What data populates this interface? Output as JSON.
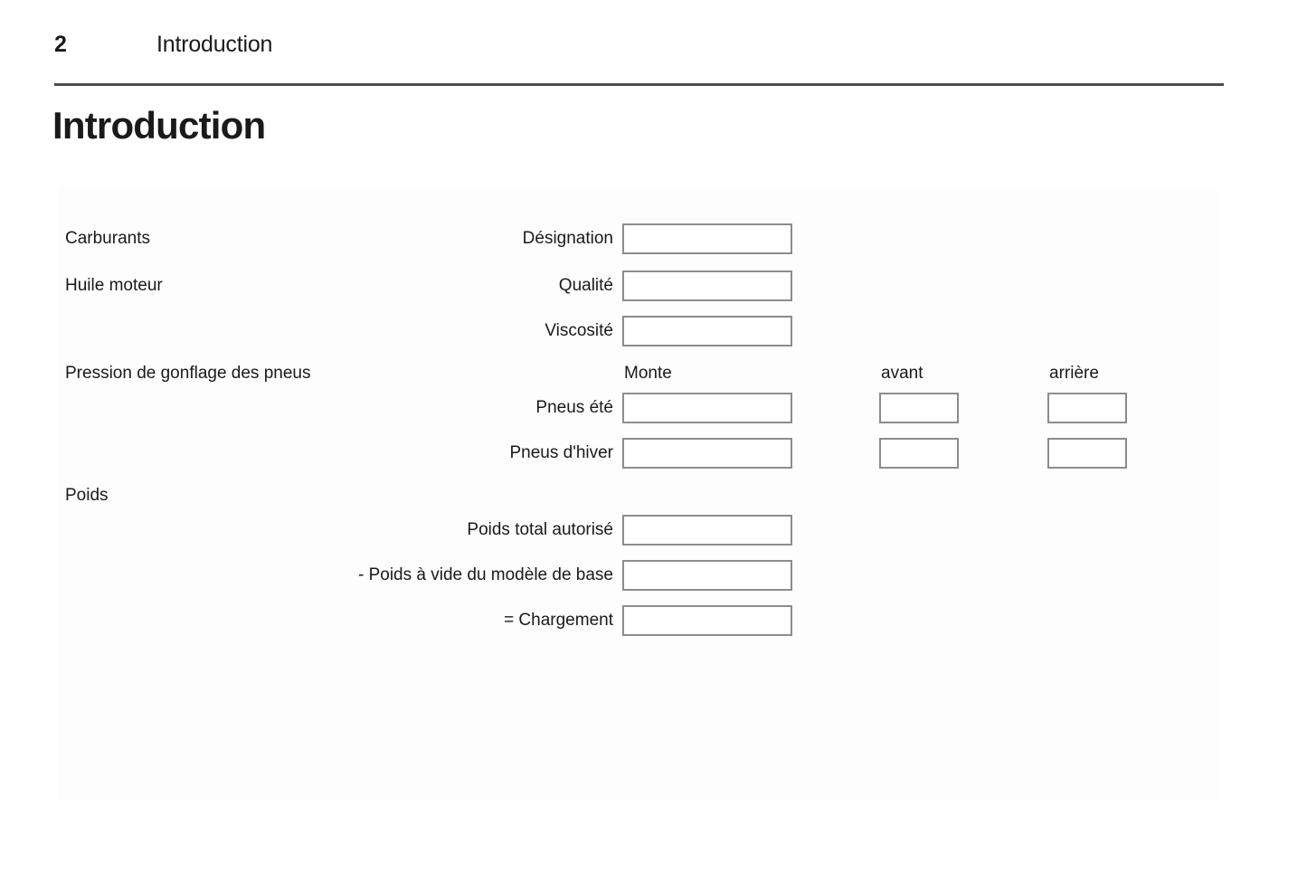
{
  "header": {
    "page_number": "2",
    "section": "Introduction"
  },
  "chapter_title": "Introduction",
  "panel": {
    "groups": {
      "fuels": "Carburants",
      "engine_oil": "Huile moteur",
      "tyre_pressure": "Pression de gonflage des pneus",
      "weights": "Poids"
    },
    "column_headers": {
      "monte": "Monte",
      "front": "avant",
      "rear": "arrière"
    },
    "fields": {
      "designation": "Désignation",
      "quality": "Qualité",
      "viscosity": "Viscosité",
      "summer_tyres": "Pneus été",
      "winter_tyres": "Pneus d'hiver",
      "gross_weight": "Poids total autorisé",
      "kerb_weight": "- Poids à vide du modèle de base",
      "payload": "= Chargement"
    },
    "values": {
      "designation": "",
      "quality": "",
      "viscosity": "",
      "summer_monte": "",
      "summer_front": "",
      "summer_rear": "",
      "winter_monte": "",
      "winter_front": "",
      "winter_rear": "",
      "gross_weight": "",
      "kerb_weight": "",
      "payload": ""
    }
  },
  "colors": {
    "rule": "#4d4d4d",
    "box_border": "#8c8c8c",
    "panel_background": "#fdfdfd",
    "text": "#1a1a1a"
  }
}
